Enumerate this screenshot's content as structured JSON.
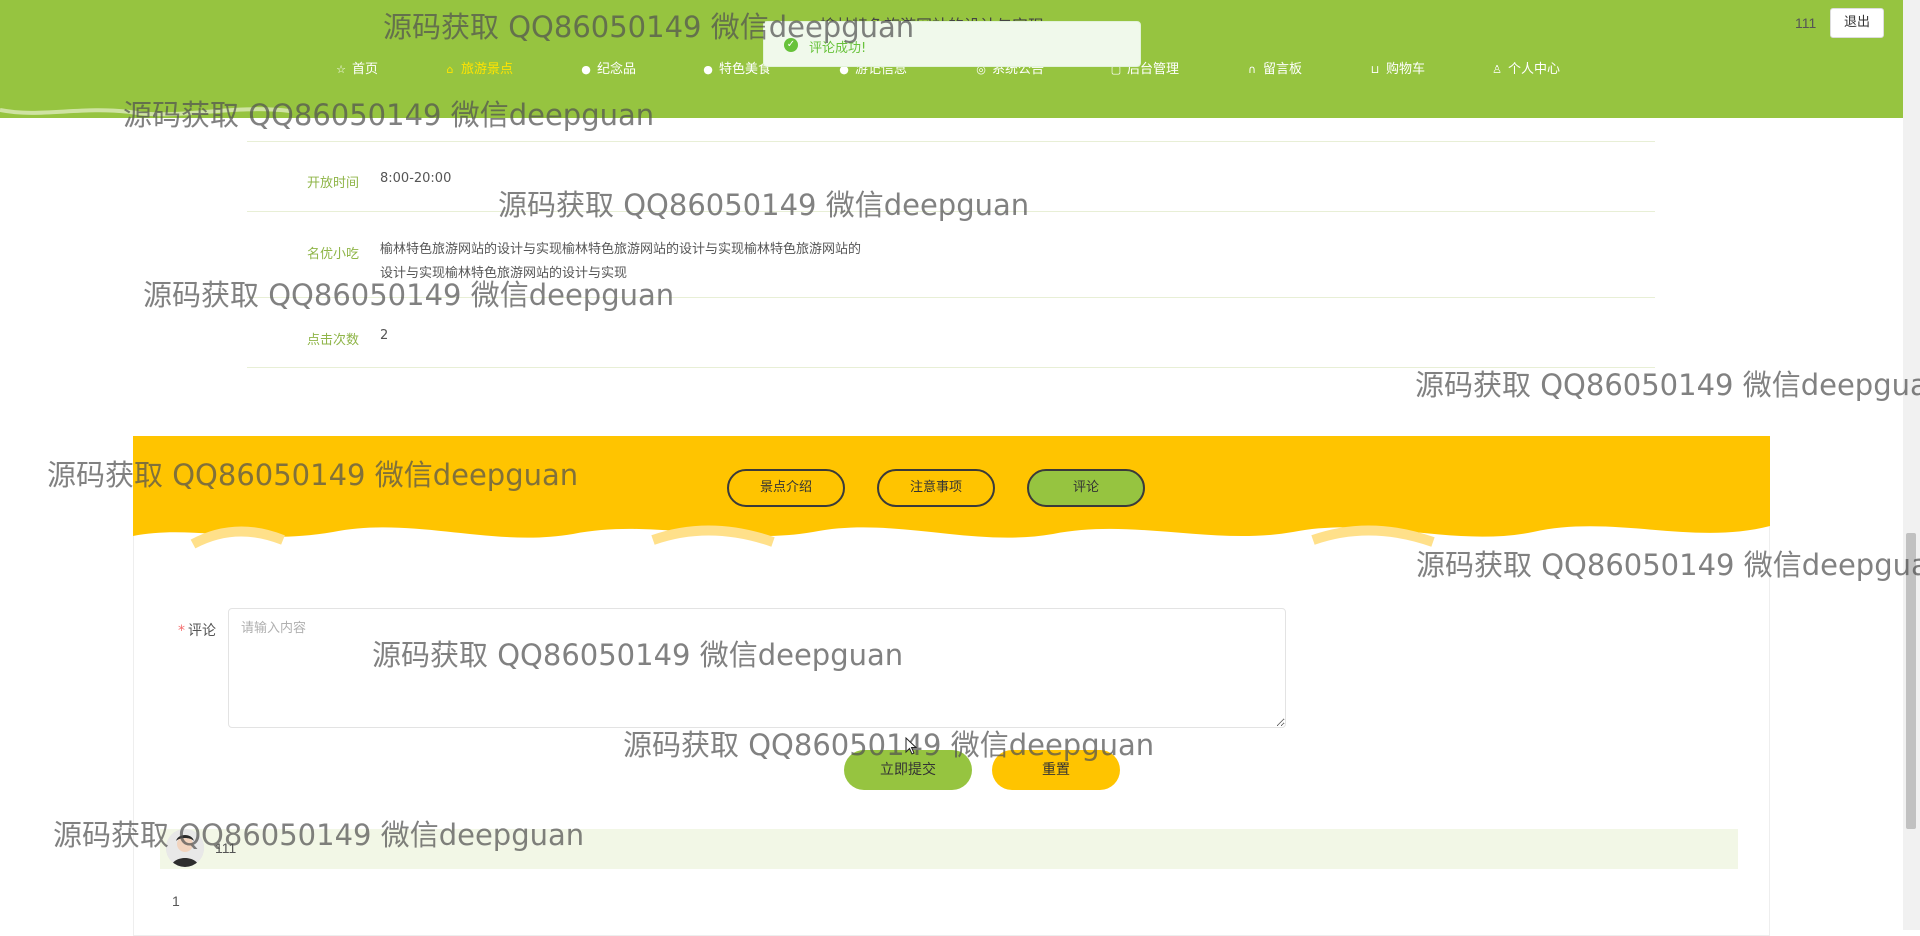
{
  "header": {
    "site_title": "榆林特色旅游网站的设计与实现",
    "user_name": "111",
    "logout_label": "退出"
  },
  "nav": [
    {
      "icon": "star-icon",
      "glyph": "☆",
      "label": "首页"
    },
    {
      "icon": "bag-icon",
      "glyph": "⌂",
      "label": "旅游景点"
    },
    {
      "icon": "info-icon",
      "glyph": "●",
      "label": "纪念品"
    },
    {
      "icon": "info-icon",
      "glyph": "●",
      "label": "特色美食"
    },
    {
      "icon": "info-icon",
      "glyph": "●",
      "label": "游记信息"
    },
    {
      "icon": "compass-icon",
      "glyph": "◎",
      "label": "系统公告"
    },
    {
      "icon": "edit-icon",
      "glyph": "▢",
      "label": "后台管理"
    },
    {
      "icon": "headset-icon",
      "glyph": "∩",
      "label": "留言板"
    },
    {
      "icon": "cart-icon",
      "glyph": "⊔",
      "label": "购物车"
    },
    {
      "icon": "user-icon",
      "glyph": "♙",
      "label": "个人中心"
    }
  ],
  "toast": {
    "message": "评论成功!"
  },
  "details": [
    {
      "label": "开放时间",
      "value": "8:00-20:00"
    },
    {
      "label": "名优小吃",
      "value": "榆林特色旅游网站的设计与实现榆林特色旅游网站的设计与实现榆林特色旅游网站的设计与实现榆林特色旅游网站的设计与实现"
    },
    {
      "label": "点击次数",
      "value": "2"
    }
  ],
  "tabs": [
    {
      "label": "景点介绍",
      "active": false
    },
    {
      "label": "注意事项",
      "active": false
    },
    {
      "label": "评论",
      "active": true
    }
  ],
  "form": {
    "label": "评论",
    "required_mark": "*",
    "placeholder": "请输入内容",
    "submit_label": "立即提交",
    "reset_label": "重置"
  },
  "comments": [
    {
      "user": "111",
      "content": "1"
    }
  ],
  "watermark": "源码获取 QQ86050149 微信deepguan",
  "colors": {
    "header_green": "#96c440",
    "tab_band_yellow": "#ffc400",
    "active_nav": "#ffe400",
    "success": "#67c23a"
  }
}
